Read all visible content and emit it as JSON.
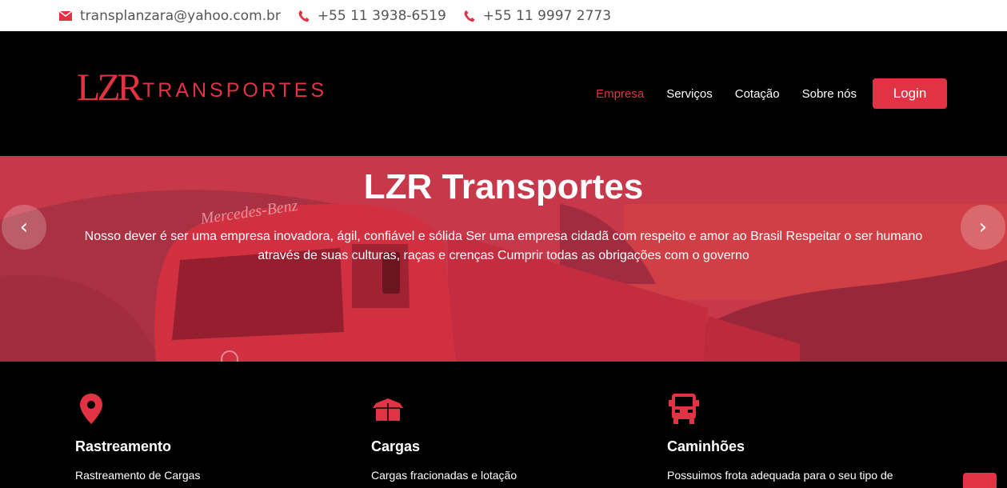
{
  "topbar": {
    "email": "transplanzara@yahoo.com.br",
    "phone1": "+55 11 3938-6519",
    "phone2": "+55 11 9997 2773"
  },
  "logo": {
    "mark": "LZR",
    "word": "TRANSPORTES"
  },
  "nav": {
    "items": [
      "Empresa",
      "Serviços",
      "Cotação",
      "Sobre nós"
    ],
    "active": "Empresa",
    "login": "Login"
  },
  "hero": {
    "title": "LZR Transportes",
    "text": "Nosso dever é ser uma empresa inovadora, ágil, confiável e sólida Ser uma empresa cidadã com respeito e amor ao Brasil Respeitar o ser humano através de suas culturas, raças e crenças Cumprir todas as obrigações com o governo",
    "truck_brand": "Mercedes-Benz",
    "prev_icon": "chevron-left-icon",
    "next_icon": "chevron-right-icon"
  },
  "features": [
    {
      "icon": "map-pin-icon",
      "title": "Rastreamento",
      "desc": "Rastreamento de Cargas"
    },
    {
      "icon": "box-icon",
      "title": "Cargas",
      "desc": "Cargas fracionadas e lotação"
    },
    {
      "icon": "truck-icon",
      "title": "Caminhões",
      "desc": "Possuimos frota adequada para o seu tipo de"
    }
  ],
  "colors": {
    "accent": "#e13343",
    "background": "#000000",
    "topbar_text": "#555555"
  }
}
